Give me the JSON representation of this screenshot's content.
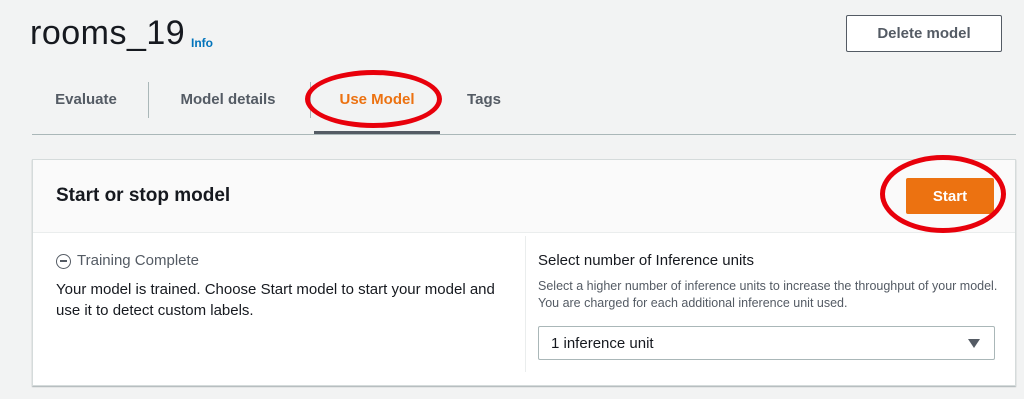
{
  "header": {
    "title": "rooms_19",
    "info_label": "Info",
    "delete_label": "Delete model"
  },
  "tabs": [
    {
      "label": "Evaluate",
      "active": false
    },
    {
      "label": "Model details",
      "active": false
    },
    {
      "label": "Use Model",
      "active": true
    },
    {
      "label": "Tags",
      "active": false
    }
  ],
  "panel": {
    "title": "Start or stop model",
    "start_label": "Start",
    "status": {
      "icon": "minus-circle-icon",
      "label": "Training Complete"
    },
    "description": "Your model is trained. Choose Start model to start your model and use it to detect custom labels.",
    "inference": {
      "label": "Select number of Inference units",
      "description": "Select a higher number of inference units to increase the throughput of your model. You are charged for each additional inference unit used.",
      "selected": "1 inference unit"
    }
  },
  "colors": {
    "accent": "#ec7211",
    "link": "#0073bb",
    "annotation": "#e8000b"
  }
}
